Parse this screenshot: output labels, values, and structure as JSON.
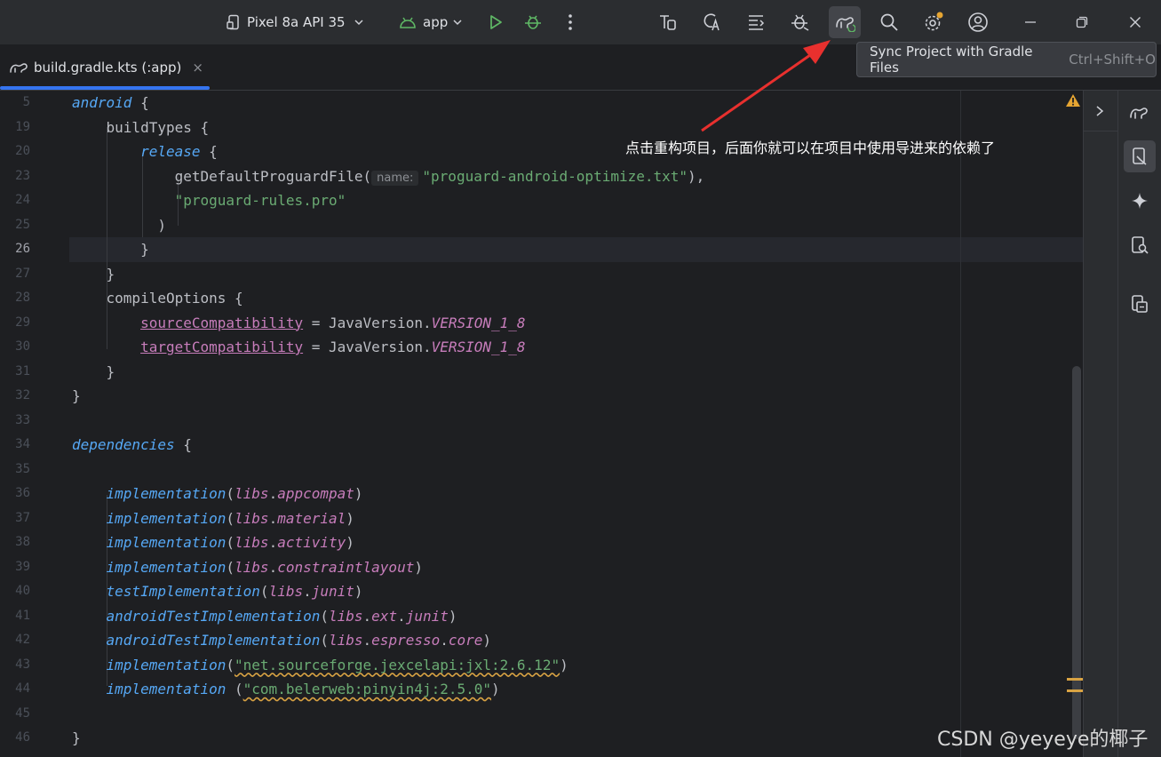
{
  "titlebar": {
    "device": "Pixel 8a API 35",
    "module": "app",
    "tooltip": {
      "label": "Sync Project with Gradle Files",
      "shortcut": "Ctrl+Shift+O"
    }
  },
  "tab": {
    "label": "build.gradle.kts (:app)",
    "close": "×"
  },
  "editor": {
    "line_numbers": [
      "5",
      "19",
      "20",
      "23",
      "24",
      "25",
      "26",
      "27",
      "28",
      "29",
      "30",
      "31",
      "32",
      "33",
      "34",
      "35",
      "36",
      "37",
      "38",
      "39",
      "40",
      "41",
      "42",
      "43",
      "44",
      "45",
      "46"
    ],
    "current_line": "26",
    "lines": [
      [
        {
          "t": "android",
          "c": "kw"
        },
        {
          "t": " {",
          "c": ""
        }
      ],
      [
        {
          "t": "    buildTypes {",
          "c": ""
        }
      ],
      [
        {
          "t": "        ",
          "c": ""
        },
        {
          "t": "release",
          "c": "kw"
        },
        {
          "t": " {",
          "c": ""
        }
      ],
      [
        {
          "t": "            getDefaultProguardFile(",
          "c": ""
        },
        {
          "t": "name:",
          "c": "hint"
        },
        {
          "t": "\"proguard-android-optimize.txt\"",
          "c": "str"
        },
        {
          "t": "),",
          "c": ""
        }
      ],
      [
        {
          "t": "            ",
          "c": ""
        },
        {
          "t": "\"proguard-rules.pro\"",
          "c": "str"
        }
      ],
      [
        {
          "t": "          )",
          "c": ""
        }
      ],
      [
        {
          "t": "        }",
          "c": ""
        }
      ],
      [
        {
          "t": "    }",
          "c": ""
        }
      ],
      [
        {
          "t": "    compileOptions {",
          "c": ""
        }
      ],
      [
        {
          "t": "        ",
          "c": ""
        },
        {
          "t": "sourceCompatibility",
          "c": "prop"
        },
        {
          "t": " = JavaVersion.",
          "c": ""
        },
        {
          "t": "VERSION_1_8",
          "c": "ital"
        }
      ],
      [
        {
          "t": "        ",
          "c": ""
        },
        {
          "t": "targetCompatibility",
          "c": "prop"
        },
        {
          "t": " = JavaVersion.",
          "c": ""
        },
        {
          "t": "VERSION_1_8",
          "c": "ital"
        }
      ],
      [
        {
          "t": "    }",
          "c": ""
        }
      ],
      [
        {
          "t": "}",
          "c": ""
        }
      ],
      [],
      [
        {
          "t": "dependencies",
          "c": "kw"
        },
        {
          "t": " {",
          "c": ""
        }
      ],
      [],
      [
        {
          "t": "    ",
          "c": ""
        },
        {
          "t": "implementation",
          "c": "fn"
        },
        {
          "t": "(",
          "c": ""
        },
        {
          "t": "libs",
          "c": "ital"
        },
        {
          "t": ".",
          "c": ""
        },
        {
          "t": "appcompat",
          "c": "ital"
        },
        {
          "t": ")",
          "c": ""
        }
      ],
      [
        {
          "t": "    ",
          "c": ""
        },
        {
          "t": "implementation",
          "c": "fn"
        },
        {
          "t": "(",
          "c": ""
        },
        {
          "t": "libs",
          "c": "ital"
        },
        {
          "t": ".",
          "c": ""
        },
        {
          "t": "material",
          "c": "ital"
        },
        {
          "t": ")",
          "c": ""
        }
      ],
      [
        {
          "t": "    ",
          "c": ""
        },
        {
          "t": "implementation",
          "c": "fn"
        },
        {
          "t": "(",
          "c": ""
        },
        {
          "t": "libs",
          "c": "ital"
        },
        {
          "t": ".",
          "c": ""
        },
        {
          "t": "activity",
          "c": "ital"
        },
        {
          "t": ")",
          "c": ""
        }
      ],
      [
        {
          "t": "    ",
          "c": ""
        },
        {
          "t": "implementation",
          "c": "fn"
        },
        {
          "t": "(",
          "c": ""
        },
        {
          "t": "libs",
          "c": "ital"
        },
        {
          "t": ".",
          "c": ""
        },
        {
          "t": "constraintlayout",
          "c": "ital"
        },
        {
          "t": ")",
          "c": ""
        }
      ],
      [
        {
          "t": "    ",
          "c": ""
        },
        {
          "t": "testImplementation",
          "c": "fn"
        },
        {
          "t": "(",
          "c": ""
        },
        {
          "t": "libs",
          "c": "ital"
        },
        {
          "t": ".",
          "c": ""
        },
        {
          "t": "junit",
          "c": "ital"
        },
        {
          "t": ")",
          "c": ""
        }
      ],
      [
        {
          "t": "    ",
          "c": ""
        },
        {
          "t": "androidTestImplementation",
          "c": "fn"
        },
        {
          "t": "(",
          "c": ""
        },
        {
          "t": "libs",
          "c": "ital"
        },
        {
          "t": ".",
          "c": ""
        },
        {
          "t": "ext",
          "c": "ital"
        },
        {
          "t": ".",
          "c": ""
        },
        {
          "t": "junit",
          "c": "ital"
        },
        {
          "t": ")",
          "c": ""
        }
      ],
      [
        {
          "t": "    ",
          "c": ""
        },
        {
          "t": "androidTestImplementation",
          "c": "fn"
        },
        {
          "t": "(",
          "c": ""
        },
        {
          "t": "libs",
          "c": "ital"
        },
        {
          "t": ".",
          "c": ""
        },
        {
          "t": "espresso",
          "c": "ital"
        },
        {
          "t": ".",
          "c": ""
        },
        {
          "t": "core",
          "c": "ital"
        },
        {
          "t": ")",
          "c": ""
        }
      ],
      [
        {
          "t": "    ",
          "c": ""
        },
        {
          "t": "implementation",
          "c": "fn"
        },
        {
          "t": "(",
          "c": ""
        },
        {
          "t": "\"net.sourceforge.jexcelapi:jxl:2.6.12\"",
          "c": "str warn-ul"
        },
        {
          "t": ")",
          "c": ""
        }
      ],
      [
        {
          "t": "    ",
          "c": ""
        },
        {
          "t": "implementation",
          "c": "fn"
        },
        {
          "t": " (",
          "c": ""
        },
        {
          "t": "\"com.belerweb:pinyin4j:2.5.0\"",
          "c": "str warn-ul"
        },
        {
          "t": ")",
          "c": ""
        }
      ],
      [],
      [
        {
          "t": "}",
          "c": ""
        }
      ]
    ]
  },
  "annotation": "点击重构项目，后面你就可以在项目中使用导进来的依赖了",
  "watermark": "CSDN @yeyeye的椰子",
  "colors": {
    "accent": "#3574f0",
    "arrow": "#e8302e",
    "warning": "#d9a343"
  }
}
